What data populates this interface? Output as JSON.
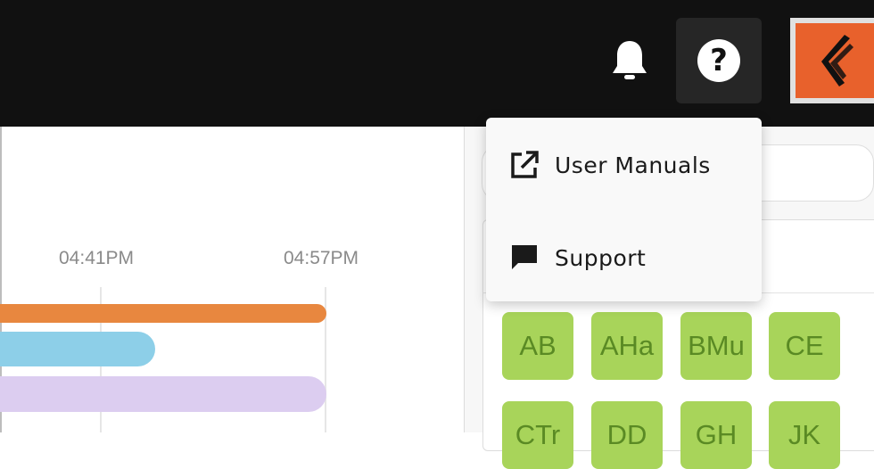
{
  "header": {
    "notifications_icon": "bell-icon",
    "help_icon": "question-circle-icon",
    "help_glyph": "?",
    "avatar_icon": "brand-logo-icon"
  },
  "help_menu": {
    "items": [
      {
        "label": "User Manuals",
        "icon": "external-link-icon"
      },
      {
        "label": "Support",
        "icon": "chat-bubble-icon"
      }
    ]
  },
  "timeline": {
    "time_labels": [
      "04:41PM",
      "04:57PM"
    ],
    "bar_colors": [
      "#e8873f",
      "#8dcfe8",
      "#dccdf0"
    ]
  },
  "tiles": {
    "row1": [
      "AB",
      "AHa",
      "BMu",
      "CE"
    ],
    "row2": [
      "CTr",
      "DD",
      "GH",
      "JK"
    ]
  },
  "colors": {
    "topbar": "#111111",
    "tile_bg": "#a8d45a",
    "tile_text": "#5a8a24",
    "avatar": "#e8612c"
  }
}
